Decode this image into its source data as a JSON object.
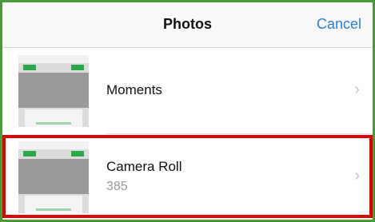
{
  "navbar": {
    "title": "Photos",
    "cancel_label": "Cancel"
  },
  "albums": [
    {
      "label": "Moments"
    },
    {
      "label": "Camera Roll",
      "count": "385",
      "highlighted": true
    }
  ],
  "icons": {
    "chevron": "›"
  },
  "colors": {
    "frame_border": "#4a9a3c",
    "highlight_border": "#e00000",
    "link_blue": "#2f7fd6"
  }
}
